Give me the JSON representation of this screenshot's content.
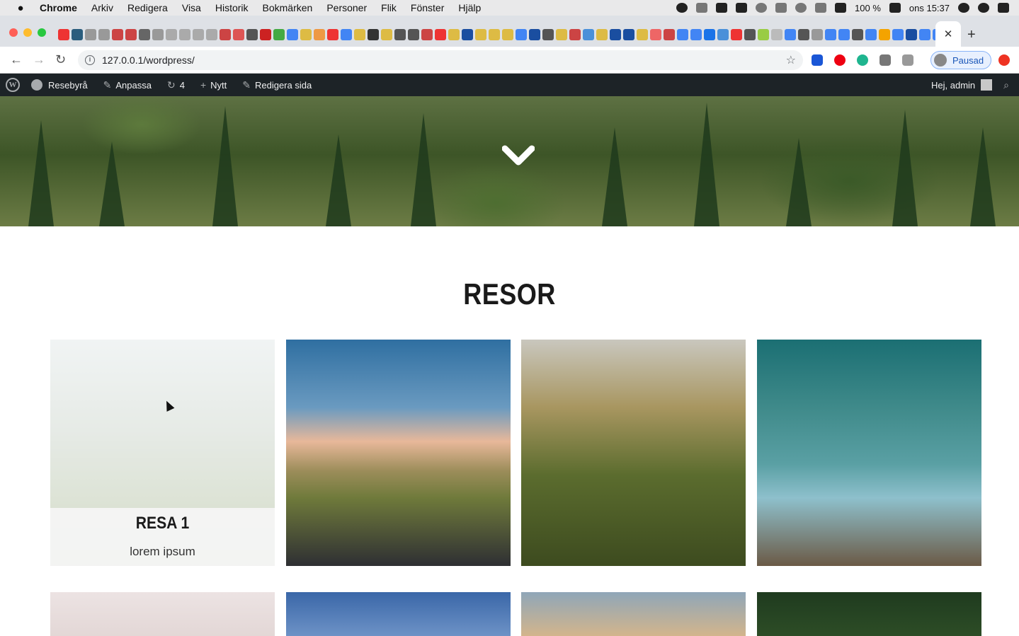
{
  "menubar": {
    "app": "Chrome",
    "items": [
      "Arkiv",
      "Redigera",
      "Visa",
      "Historik",
      "Bokmärken",
      "Personer",
      "Flik",
      "Fönster",
      "Hjälp"
    ],
    "battery": "100 %",
    "clock": "ons 15:37"
  },
  "browser": {
    "url": "127.0.0.1/wordpress/",
    "profile_label": "Pausad",
    "close_tab_glyph": "✕",
    "new_tab_glyph": "+"
  },
  "adminbar": {
    "site_name": "Resebyrå",
    "customize": "Anpassa",
    "updates_count": "4",
    "new": "Nytt",
    "edit_page": "Redigera sida",
    "greeting": "Hej, admin"
  },
  "page": {
    "section_title": "RESOR",
    "cards": [
      {
        "title": "RESA 1",
        "text": "lorem ipsum"
      }
    ]
  },
  "colors": {
    "adminbar_bg": "#1d2327",
    "accent_blue": "#1a56b8"
  }
}
